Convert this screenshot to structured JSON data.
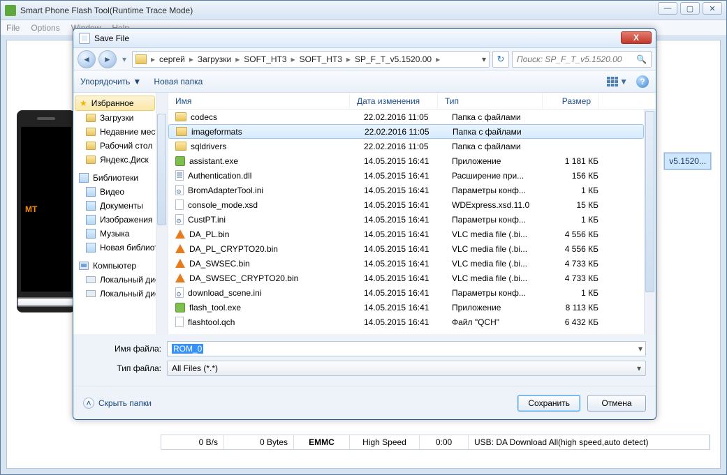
{
  "parent": {
    "title": "Smart Phone Flash Tool(Runtime Trace Mode)",
    "menu": [
      "File",
      "Options",
      "Window",
      "Help"
    ],
    "phone_brand": "MT",
    "side_chip": "v5.1520...",
    "status": {
      "bs": "0 B/s",
      "bytes": "0 Bytes",
      "storage": "EMMC",
      "speed": "High Speed",
      "time": "0:00",
      "usb": "USB: DA Download All(high speed,auto detect)"
    }
  },
  "dialog": {
    "title": "Save File",
    "breadcrumbs": [
      "сергей",
      "Загрузки",
      "SOFT_HT3",
      "SOFT_HT3",
      "SP_F_T_v5.1520.00"
    ],
    "search_placeholder": "Поиск: SP_F_T_v5.1520.00",
    "toolbar": {
      "organize": "Упорядочить",
      "newfolder": "Новая папка"
    },
    "tree": {
      "fav": "Избранное",
      "fav_items": [
        "Загрузки",
        "Недавние места",
        "Рабочий стол",
        "Яндекс.Диск"
      ],
      "lib": "Библиотеки",
      "lib_items": [
        "Видео",
        "Документы",
        "Изображения",
        "Музыка",
        "Новая библиоте"
      ],
      "pc": "Компьютер",
      "pc_items": [
        "Локальный диск",
        "Локальный диск"
      ]
    },
    "columns": {
      "name": "Имя",
      "date": "Дата изменения",
      "type": "Тип",
      "size": "Размер"
    },
    "rows": [
      {
        "icon": "folder",
        "name": "codecs",
        "date": "22.02.2016 11:05",
        "type": "Папка с файлами",
        "size": ""
      },
      {
        "icon": "folder",
        "name": "imageformats",
        "date": "22.02.2016 11:05",
        "type": "Папка с файлами",
        "size": "",
        "sel": true
      },
      {
        "icon": "folder",
        "name": "sqldrivers",
        "date": "22.02.2016 11:05",
        "type": "Папка с файлами",
        "size": ""
      },
      {
        "icon": "exe",
        "name": "assistant.exe",
        "date": "14.05.2015 16:41",
        "type": "Приложение",
        "size": "1 181 КБ"
      },
      {
        "icon": "dll",
        "name": "Authentication.dll",
        "date": "14.05.2015 16:41",
        "type": "Расширение при...",
        "size": "156 КБ"
      },
      {
        "icon": "ini",
        "name": "BromAdapterTool.ini",
        "date": "14.05.2015 16:41",
        "type": "Параметры конф...",
        "size": "1 КБ"
      },
      {
        "icon": "xsd",
        "name": "console_mode.xsd",
        "date": "14.05.2015 16:41",
        "type": "WDExpress.xsd.11.0",
        "size": "15 КБ"
      },
      {
        "icon": "ini",
        "name": "CustPT.ini",
        "date": "14.05.2015 16:41",
        "type": "Параметры конф...",
        "size": "1 КБ"
      },
      {
        "icon": "vlc",
        "name": "DA_PL.bin",
        "date": "14.05.2015 16:41",
        "type": "VLC media file (.bi...",
        "size": "4 556 КБ"
      },
      {
        "icon": "vlc",
        "name": "DA_PL_CRYPTO20.bin",
        "date": "14.05.2015 16:41",
        "type": "VLC media file (.bi...",
        "size": "4 556 КБ"
      },
      {
        "icon": "vlc",
        "name": "DA_SWSEC.bin",
        "date": "14.05.2015 16:41",
        "type": "VLC media file (.bi...",
        "size": "4 733 КБ"
      },
      {
        "icon": "vlc",
        "name": "DA_SWSEC_CRYPTO20.bin",
        "date": "14.05.2015 16:41",
        "type": "VLC media file (.bi...",
        "size": "4 733 КБ"
      },
      {
        "icon": "ini",
        "name": "download_scene.ini",
        "date": "14.05.2015 16:41",
        "type": "Параметры конф...",
        "size": "1 КБ"
      },
      {
        "icon": "exe",
        "name": "flash_tool.exe",
        "date": "14.05.2015 16:41",
        "type": "Приложение",
        "size": "8 113 КБ"
      },
      {
        "icon": "gen",
        "name": "flashtool.qch",
        "date": "14.05.2015 16:41",
        "type": "Файл \"QCH\"",
        "size": "6 432 КБ"
      }
    ],
    "form": {
      "name_label": "Имя файла:",
      "name_value": "ROM_0",
      "type_label": "Тип файла:",
      "type_value": "All Files (*.*)"
    },
    "footer": {
      "hide": "Скрыть папки",
      "save": "Сохранить",
      "cancel": "Отмена"
    }
  }
}
